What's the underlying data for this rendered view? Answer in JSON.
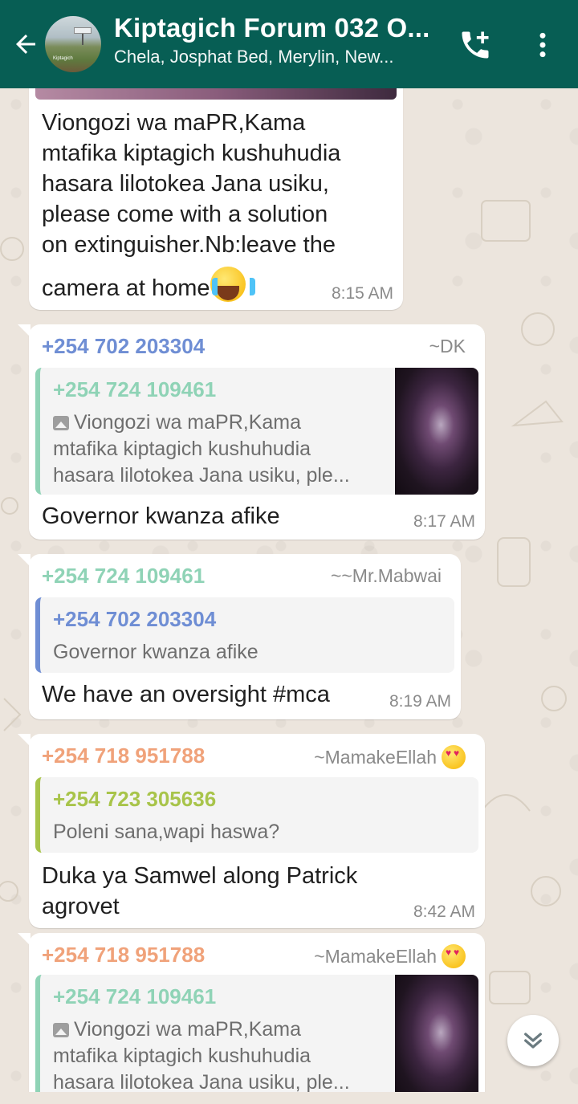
{
  "header": {
    "title": "Kiptagich Forum 032 O...",
    "subtitle": "Chela, Josphat Bed, Merylin, New...",
    "avatar_caption": "Kiptagich",
    "icons": {
      "back": "arrow-left-icon",
      "call": "add-call-icon",
      "menu": "more-vert-icon"
    },
    "color": "#075e54"
  },
  "messages": [
    {
      "text_lines": [
        "Viongozi wa maPR,Kama",
        "mtafika kiptagich kushuhudia",
        "hasara lilotokea Jana usiku,",
        "please come with a solution",
        "on  extinguisher.Nb:leave the",
        "camera at home"
      ],
      "emoji": "loudly-crying-face",
      "time": "8:15 AM"
    },
    {
      "sender": "+254 702 203304",
      "sender_color": "#6f8ed4",
      "alias": "~DK",
      "quote": {
        "sender": "+254 724 109461",
        "sender_color": "#8fd3b6",
        "icon": "image-icon",
        "lines": [
          "Viongozi wa maPR,Kama",
          "mtafika kiptagich kushuhudia",
          "hasara lilotokea Jana usiku, ple..."
        ]
      },
      "text": "Governor kwanza afike",
      "time": "8:17 AM"
    },
    {
      "sender": "+254 724 109461",
      "sender_color": "#8fd3b6",
      "alias": "~~Mr.Mabwai",
      "quote": {
        "sender": "+254 702 203304",
        "sender_color": "#6f8ed4",
        "lines": [
          "Governor kwanza afike"
        ]
      },
      "text": "We have an oversight #mca",
      "time": "8:19 AM"
    },
    {
      "sender": "+254 718 951788",
      "sender_color": "#f0a27a",
      "alias": "~MamakeEllah",
      "alias_emoji": "smiling-face-with-heart-eyes",
      "quote": {
        "sender": "+254 723 305636",
        "sender_color": "#a8c44a",
        "lines": [
          "Poleni sana,wapi haswa?"
        ]
      },
      "text_lines": [
        "Duka ya Samwel along Patrick",
        "agrovet"
      ],
      "time": "8:42 AM"
    },
    {
      "sender": "+254 718 951788",
      "sender_color": "#f0a27a",
      "alias": "~MamakeEllah",
      "alias_emoji": "smiling-face-with-heart-eyes",
      "quote": {
        "sender": "+254 724 109461",
        "sender_color": "#8fd3b6",
        "icon": "image-icon",
        "lines": [
          "Viongozi wa maPR,Kama",
          "mtafika kiptagich kushuhudia",
          "hasara lilotokea Jana usiku, ple..."
        ]
      },
      "partial": true
    }
  ],
  "scroll_button_icon": "double-chevron-down-icon"
}
